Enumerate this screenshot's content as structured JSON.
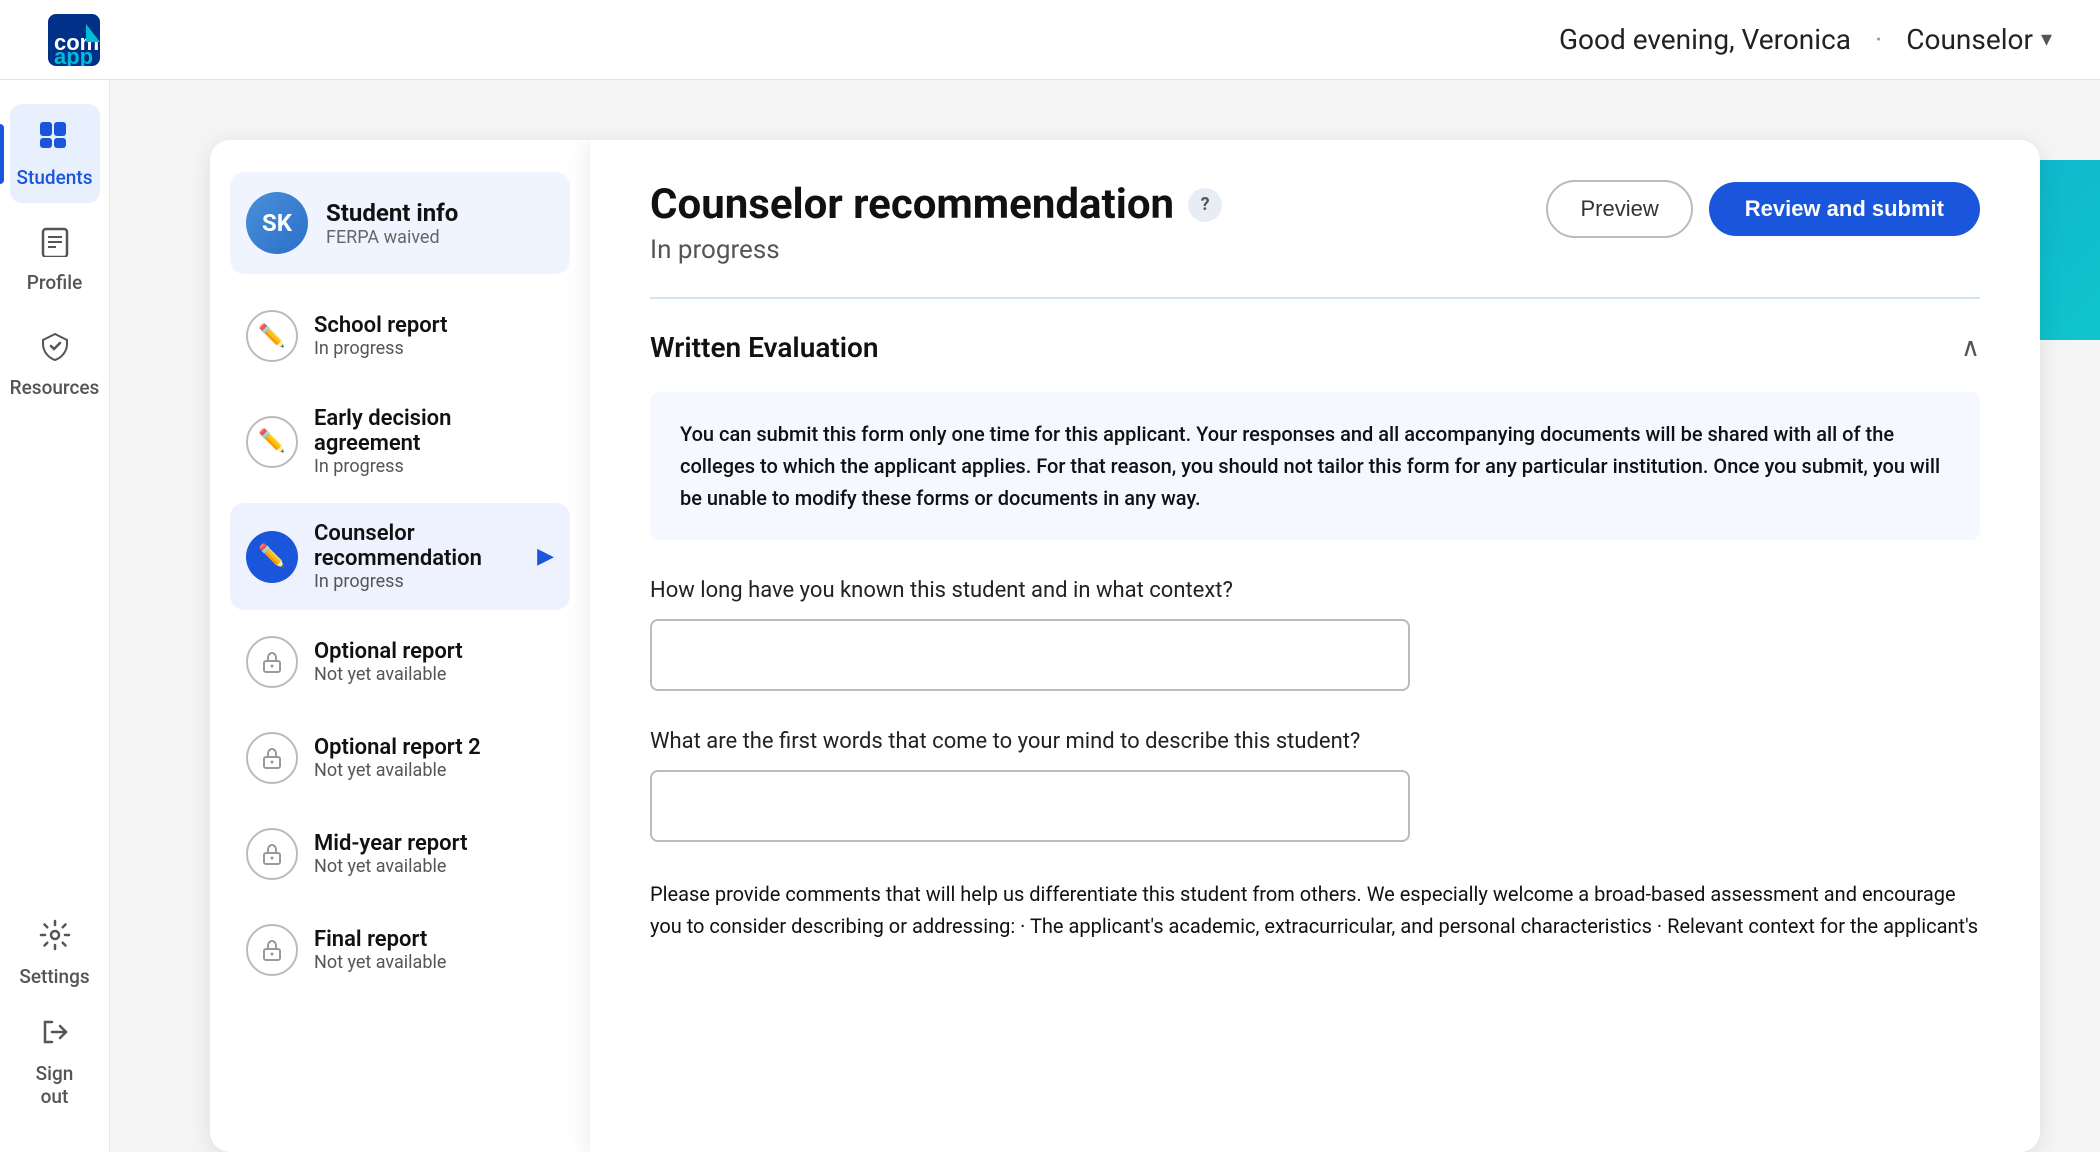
{
  "topNav": {
    "greeting": "Good evening, Veronica",
    "separator": "·",
    "role": "Counselor",
    "logoAlt": "Common App"
  },
  "sidebar": {
    "items": [
      {
        "id": "students",
        "label": "Students",
        "icon": "⊞",
        "active": true
      },
      {
        "id": "profile",
        "label": "Profile",
        "icon": "📋",
        "active": false
      },
      {
        "id": "resources",
        "label": "Resources",
        "icon": "✈",
        "active": false
      },
      {
        "id": "settings",
        "label": "Settings",
        "icon": "⚙",
        "active": false
      }
    ],
    "bottomItems": [
      {
        "id": "signout",
        "label": "Sign out",
        "icon": "↩"
      }
    ]
  },
  "leftPanel": {
    "studentInfo": {
      "initials": "SK",
      "name": "Student info",
      "sub": "FERPA waived"
    },
    "navItems": [
      {
        "id": "school-report",
        "title": "School report",
        "status": "In progress",
        "iconType": "outlined",
        "icon": "✏",
        "active": false
      },
      {
        "id": "early-decision",
        "title": "Early decision agreement",
        "status": "In progress",
        "iconType": "outlined",
        "icon": "✏",
        "active": false
      },
      {
        "id": "counselor-rec",
        "title": "Counselor recommendation",
        "status": "In progress",
        "iconType": "blue-filled",
        "icon": "✏",
        "active": true,
        "hasArrow": true
      },
      {
        "id": "optional-report",
        "title": "Optional report",
        "status": "Not yet available",
        "iconType": "locked",
        "icon": "🔒",
        "active": false
      },
      {
        "id": "optional-report-2",
        "title": "Optional report 2",
        "status": "Not yet available",
        "iconType": "locked",
        "icon": "🔒",
        "active": false
      },
      {
        "id": "mid-year",
        "title": "Mid-year report",
        "status": "Not yet available",
        "iconType": "locked",
        "icon": "🔒",
        "active": false
      },
      {
        "id": "final-report",
        "title": "Final report",
        "status": "Not yet available",
        "iconType": "locked",
        "icon": "🔒",
        "active": false
      }
    ]
  },
  "rightPanel": {
    "title": "Counselor recommendation",
    "status": "In progress",
    "buttons": {
      "preview": "Preview",
      "reviewSubmit": "Review and submit"
    },
    "section": {
      "title": "Written Evaluation",
      "notice": "You can submit this form only one time for this applicant. Your responses and all accompanying documents will be shared with all of the colleges to which the applicant applies. For that reason, you should not tailor this form for any particular institution. Once you submit, you will be unable to modify these forms or documents in any way.",
      "field1Label": "How long have you known this student and in what context?",
      "field1Value": "",
      "field2Label": "What are the first words that come to your mind to describe this student?",
      "field2Value": "",
      "field3Text": "Please provide comments that will help us differentiate this student from others. We especially welcome a broad-based assessment and encourage you to consider describing or addressing: · The applicant's academic, extracurricular, and personal characteristics · Relevant context for the applicant's"
    }
  }
}
